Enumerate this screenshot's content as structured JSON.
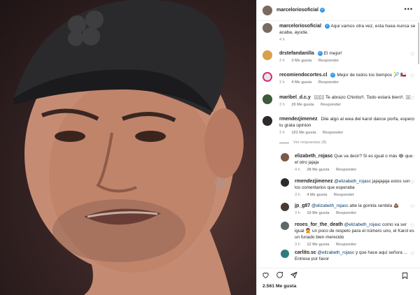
{
  "post": {
    "author": "marceloriosoficial",
    "caption": "Aqui vamos otra vez, esta huea nunca se acaba, ayuda.",
    "caption_time": "4 h",
    "likes": "2.561 Me gusta"
  },
  "comments": [
    {
      "user": "drstefandanilla",
      "verified": true,
      "text": "El mejor!",
      "time": "3 h",
      "likes": "3 Me gusta",
      "reply": "Responder"
    },
    {
      "user": "recomiendocortes.cl",
      "verified": true,
      "text": "Mejor de todos los tiempos 🎾 🇨🇱",
      "time": "3 h",
      "likes": "4 Me gusta",
      "reply": "Responder"
    },
    {
      "user": "maribel_d.c.y",
      "verified": false,
      "text": "▯▯▯▯ Te abrazo Chinito!!. Todo estará bien!!. ▯▯",
      "time": "3 h",
      "likes": "20 Me gusta",
      "reply": "Responder"
    },
    {
      "user": "rmendezjimenez",
      "verified": false,
      "text": "Dile algo al wea del karol dance porfa, espero tu grata opinion",
      "time": "3 h",
      "likes": "101 Me gusta",
      "reply": "Responder"
    }
  ],
  "view_replies": "Ver respuestas (8)",
  "replies": [
    {
      "user": "elizabeth_rojasc",
      "mention": "",
      "text": "Que va decir? Si es igual o más 😂 que el otro jajaja",
      "time": "4 h",
      "likes": "28 Me gusta",
      "reply": "Responder"
    },
    {
      "user": "rmendezjimenez",
      "mention": "@elizabeth_rojasc",
      "text": "jajajajaja estos son los comentarios que esperaba",
      "time": "3 h",
      "likes": "4 Me gusta",
      "reply": "Responder"
    },
    {
      "user": "jp_g87",
      "mention": "@elizabeth_rojasc",
      "text": "atte la gomita sentida 💩",
      "time": "3 h",
      "likes": "10 Me gusta",
      "reply": "Responder"
    },
    {
      "user": "roses_for_the_death",
      "mention": "@elizabeth_rojasc",
      "text": "como va ser igual 🤦 un poco de respeto para el número uno, el Karol es un funado bien merecido",
      "time": "3 h",
      "likes": "12 Me gusta",
      "reply": "Responder"
    },
    {
      "user": "carlito.sc",
      "mention": "@elizabeth_rojasc",
      "text": "y que hace aquí señora ... Entrese por favor",
      "time": "",
      "likes": "",
      "reply": ""
    }
  ],
  "icons": {
    "more": "more-options-icon",
    "heart": "heart-icon",
    "comment": "comment-icon",
    "share": "share-icon",
    "bookmark": "bookmark-icon",
    "verified": "verified-badge-icon"
  },
  "colors": {
    "accent": "#3897f0",
    "text": "#262626",
    "muted": "#8e8e8e",
    "link": "#00376b"
  }
}
